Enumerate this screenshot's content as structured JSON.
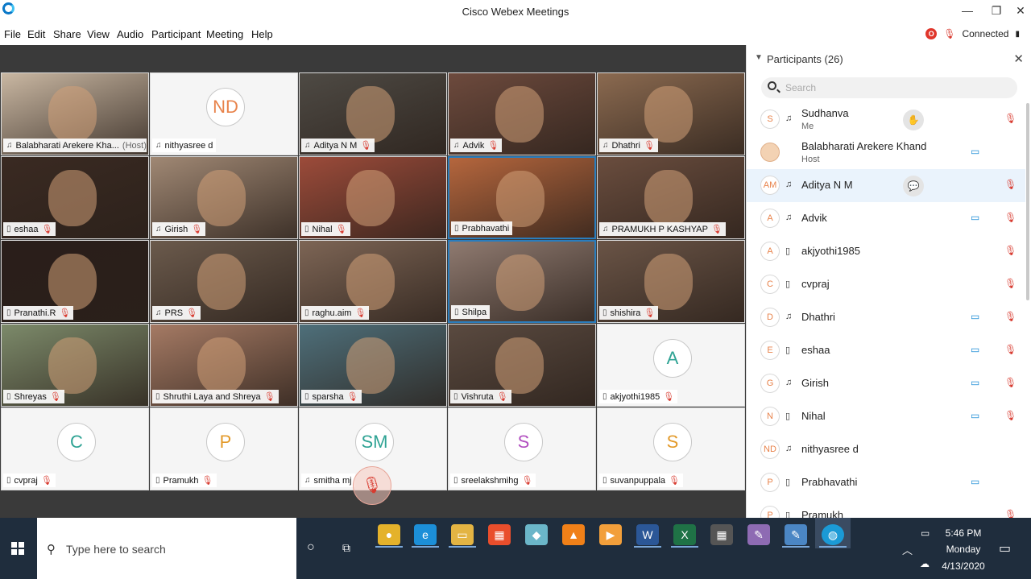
{
  "window": {
    "title": "Cisco Webex Meetings",
    "minimize": "—",
    "restore": "❐",
    "close": "✕"
  },
  "menu": [
    "File",
    "Edit",
    "Share",
    "View",
    "Audio",
    "Participant",
    "Meeting",
    "Help"
  ],
  "menu_hotkeys": [
    "F",
    "E",
    "S",
    "V",
    "A",
    "P",
    "M",
    "H"
  ],
  "status": {
    "rec_badge": "O",
    "connected": "Connected"
  },
  "tiles": [
    {
      "name": "Balabharati Arekere Kha...",
      "host": "(Host)",
      "type": "video",
      "bg": "#c9b7a2",
      "icon": "audio",
      "mute": false
    },
    {
      "name": "nithyasree d",
      "type": "avatar",
      "initials": "ND",
      "color": "#e8834b",
      "icon": "audio",
      "mute": false
    },
    {
      "name": "Aditya N M",
      "type": "video",
      "bg": "#4e4a44",
      "icon": "audio",
      "mute": true
    },
    {
      "name": "Advik",
      "type": "video",
      "bg": "#6d4a3d",
      "icon": "audio",
      "mute": true
    },
    {
      "name": "Dhathri",
      "type": "video",
      "bg": "#8b6a50",
      "icon": "audio",
      "mute": true
    },
    {
      "name": "eshaa",
      "type": "video",
      "bg": "#3a2a22",
      "icon": "phone",
      "mute": true
    },
    {
      "name": "Girish",
      "type": "video",
      "bg": "#a08874",
      "icon": "audio",
      "mute": true
    },
    {
      "name": "Nihal",
      "type": "video",
      "bg": "#9c4b3a",
      "icon": "phone",
      "mute": true
    },
    {
      "name": "Prabhavathi",
      "type": "video",
      "bg": "#b5663d",
      "icon": "phone",
      "mute": false,
      "active": true
    },
    {
      "name": "PRAMUKH P KASHYAP",
      "type": "video",
      "bg": "#6a4d3e",
      "icon": "audio",
      "mute": true
    },
    {
      "name": "Pranathi.R",
      "type": "video",
      "bg": "#2a1e1a",
      "icon": "phone",
      "mute": true
    },
    {
      "name": "PRS",
      "type": "video",
      "bg": "#6b5a4c",
      "icon": "audio",
      "mute": true
    },
    {
      "name": "raghu.aim",
      "type": "video",
      "bg": "#7d6555",
      "icon": "phone",
      "mute": true
    },
    {
      "name": "Shilpa",
      "type": "video",
      "bg": "#8f7a70",
      "icon": "phone",
      "mute": false,
      "active": true
    },
    {
      "name": "shishira",
      "type": "video",
      "bg": "#6a5446",
      "icon": "phone",
      "mute": true
    },
    {
      "name": "Shreyas",
      "type": "video",
      "bg": "#7c8a6a",
      "icon": "phone",
      "mute": true
    },
    {
      "name": "Shruthi Laya and Shreya",
      "type": "video",
      "bg": "#a57a64",
      "icon": "phone",
      "mute": true
    },
    {
      "name": "sparsha",
      "type": "video",
      "bg": "#4e6f7a",
      "icon": "phone",
      "mute": true
    },
    {
      "name": "Vishruta",
      "type": "video",
      "bg": "#5a4a40",
      "icon": "phone",
      "mute": true
    },
    {
      "name": "akjyothi1985",
      "type": "avatar",
      "initials": "A",
      "color": "#2fa394",
      "icon": "phone",
      "mute": true
    },
    {
      "name": "cvpraj",
      "type": "avatar",
      "initials": "C",
      "color": "#2fa394",
      "icon": "phone",
      "mute": true
    },
    {
      "name": "Pramukh",
      "type": "avatar",
      "initials": "P",
      "color": "#e39a2a",
      "icon": "phone",
      "mute": true
    },
    {
      "name": "smitha mj",
      "type": "avatar",
      "initials": "SM",
      "color": "#2fa394",
      "icon": "audio",
      "mute": false
    },
    {
      "name": "sreelakshmihg",
      "type": "avatar",
      "initials": "S",
      "color": "#b24fc0",
      "icon": "phone",
      "mute": true
    },
    {
      "name": "suvanpuppala",
      "type": "avatar",
      "initials": "S",
      "color": "#e39a2a",
      "icon": "phone",
      "mute": true
    }
  ],
  "panel": {
    "title": "Participants (26)",
    "search_placeholder": "Search",
    "participants": [
      {
        "initials": "S",
        "name": "Sudhanva",
        "sub": "Me",
        "conn": "audio",
        "cam": false,
        "mute": true,
        "extra": "hand"
      },
      {
        "initials": "",
        "name": "Balabharati Arekere Khand",
        "sub": "Host",
        "conn": "none",
        "cam": true,
        "mute": false,
        "photo": true
      },
      {
        "initials": "AM",
        "name": "Aditya N M",
        "conn": "audio",
        "cam": false,
        "mute": true,
        "extra": "chat",
        "selected": true
      },
      {
        "initials": "A",
        "name": "Advik",
        "conn": "audio",
        "cam": true,
        "mute": true
      },
      {
        "initials": "A",
        "name": "akjyothi1985",
        "conn": "phone",
        "cam": false,
        "mute": true
      },
      {
        "initials": "C",
        "name": "cvpraj",
        "conn": "phone",
        "cam": false,
        "mute": true
      },
      {
        "initials": "D",
        "name": "Dhathri",
        "conn": "audio",
        "cam": true,
        "mute": true
      },
      {
        "initials": "E",
        "name": "eshaa",
        "conn": "phone",
        "cam": true,
        "mute": true
      },
      {
        "initials": "G",
        "name": "Girish",
        "conn": "audio",
        "cam": true,
        "mute": true
      },
      {
        "initials": "N",
        "name": "Nihal",
        "conn": "phone",
        "cam": true,
        "mute": true
      },
      {
        "initials": "ND",
        "name": "nithyasree d",
        "conn": "audio",
        "cam": false,
        "mute": false
      },
      {
        "initials": "P",
        "name": "Prabhavathi",
        "conn": "phone",
        "cam": true,
        "mute": false
      },
      {
        "initials": "P",
        "name": "Pramukh",
        "conn": "phone",
        "cam": false,
        "mute": true
      }
    ]
  },
  "taskbar": {
    "search_text": "Type here to search",
    "time": "5:46 PM",
    "day": "Monday",
    "date": "4/13/2020"
  },
  "colors": {
    "accent_blue": "#1a8bd6",
    "mute_red": "#d83a2f",
    "active_border": "#2a7dbd",
    "taskbar": "#1f2d3d"
  }
}
